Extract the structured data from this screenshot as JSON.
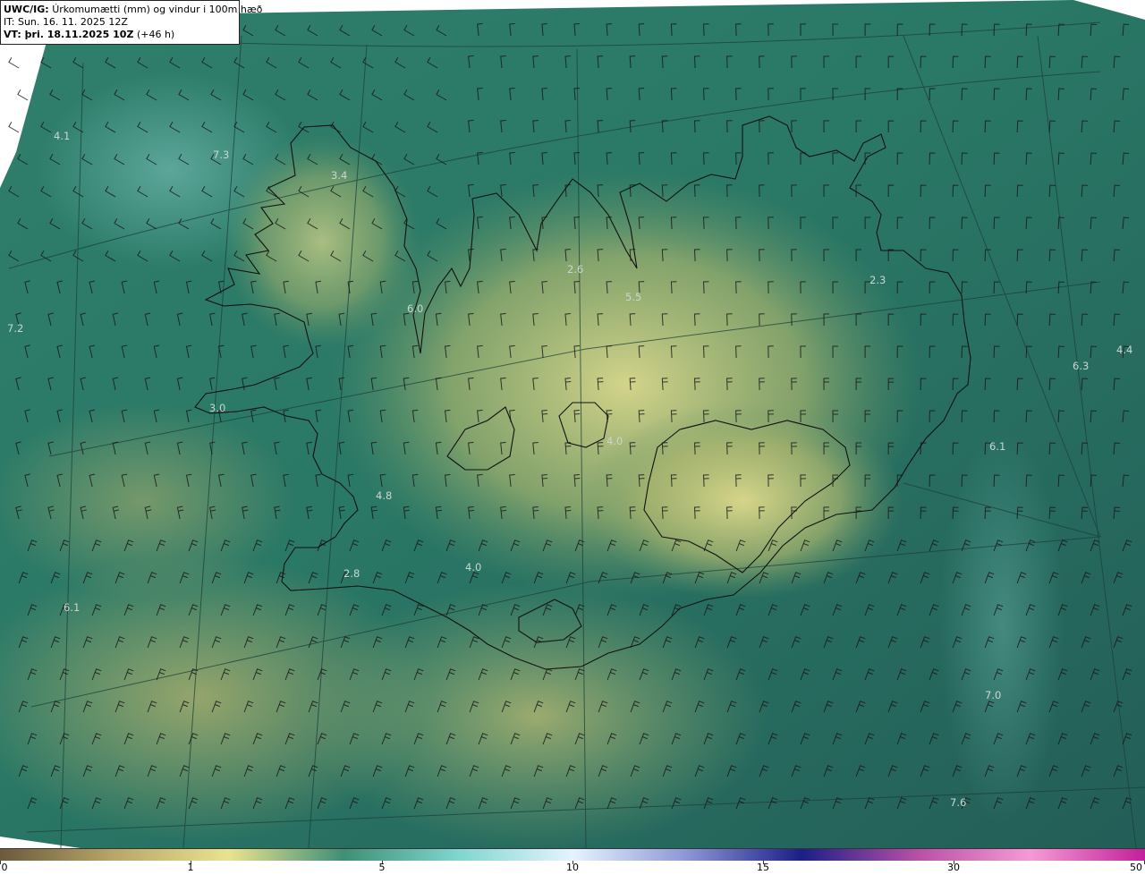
{
  "header": {
    "product": "UWC/IG:",
    "description": "Úrkomumætti (mm) og vindur i 100m hæð",
    "it_line": "IT: Sun. 16. 11. 2025 12Z",
    "vt_line": "VT: þri. 18.11.2025 10Z",
    "vt_offset": "(+46 h)"
  },
  "value_labels": [
    "4.1",
    "7.3",
    "3.4",
    "7.2",
    "6.0",
    "2.6",
    "5.5",
    "2.3",
    "4.4",
    "6.3",
    "6.1",
    "3.0",
    "4.0",
    "4.8",
    "2.8",
    "4.0",
    "6.1",
    "7.0",
    "7.6"
  ],
  "colorbar": {
    "ticks": [
      "0",
      "1",
      "5",
      "10",
      "15",
      "30",
      "50"
    ],
    "stops": [
      "#6b5a3c",
      "#b9a66a",
      "#e9e38f",
      "#3f8f76",
      "#7fd6cf",
      "#e6f3ff",
      "#8c96d6",
      "#1b1f86",
      "#b64fa6",
      "#f59ad6",
      "#c31f9a"
    ]
  },
  "colors": {
    "sea_dark": "#205f57",
    "sea_mid": "#2e7a69",
    "land_high": "#d8d68a",
    "coast": "#111111"
  }
}
